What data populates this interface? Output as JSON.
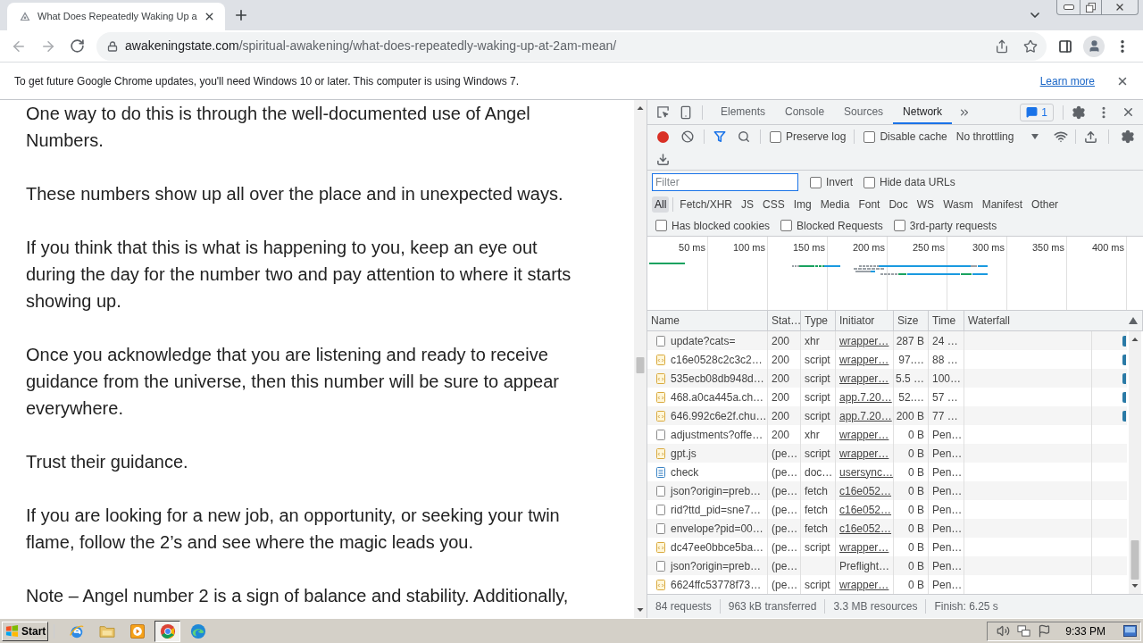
{
  "browser": {
    "tabs": [
      {
        "title": "What Does Repeatedly Waking Up a",
        "selected": true
      }
    ],
    "address": {
      "host": "awakeningstate.com",
      "path": "/spiritual-awakening/what-does-repeatedly-waking-up-at-2am-mean/"
    }
  },
  "infobar": {
    "message": "To get future Google Chrome updates, you'll need Windows 10 or later. This computer is using Windows 7.",
    "link": "Learn more"
  },
  "article": {
    "paragraphs": [
      {
        "lines": [
          "One way to do this is through the well-documented use of Angel",
          "Numbers."
        ]
      },
      {
        "lines": [
          "These numbers show up all over the place and in unexpected ways."
        ]
      },
      {
        "lines": [
          "If you think that this is what is happening to you, keep an eye out",
          "during the day for the number two and pay attention to where it starts",
          "showing up."
        ]
      },
      {
        "lines": [
          "Once you acknowledge that you are listening and ready to receive",
          "guidance from the universe, then this number will be sure to appear",
          "everywhere."
        ]
      },
      {
        "lines": [
          "Trust their guidance."
        ]
      },
      {
        "lines": [
          "If you are looking for a new job, an opportunity, or seeking your twin",
          "flame, follow the 2’s and see where the magic leads you."
        ]
      },
      {
        "lines": [
          "Note – Angel number 2 is a sign of balance and stability. Additionally,"
        ]
      }
    ]
  },
  "devtools": {
    "tabs": [
      {
        "label": "Elements",
        "selected": false
      },
      {
        "label": "Console",
        "selected": false
      },
      {
        "label": "Sources",
        "selected": false
      },
      {
        "label": "Network",
        "selected": true
      }
    ],
    "issues": "1",
    "recording": true,
    "options": [
      {
        "label": "Preserve log",
        "checked": false
      },
      {
        "label": "Disable cache",
        "checked": false
      }
    ],
    "throttling": "No throttling",
    "filter": {
      "placeholder": "Filter"
    },
    "filter_options": [
      {
        "label": "Invert",
        "checked": false
      },
      {
        "label": "Hide data URLs",
        "checked": false
      }
    ],
    "types": [
      {
        "label": "All",
        "selected": true
      },
      {
        "label": "Fetch/XHR",
        "selected": false
      },
      {
        "label": "JS",
        "selected": false
      },
      {
        "label": "CSS",
        "selected": false
      },
      {
        "label": "Img",
        "selected": false
      },
      {
        "label": "Media",
        "selected": false
      },
      {
        "label": "Font",
        "selected": false
      },
      {
        "label": "Doc",
        "selected": false
      },
      {
        "label": "WS",
        "selected": false
      },
      {
        "label": "Wasm",
        "selected": false
      },
      {
        "label": "Manifest",
        "selected": false
      },
      {
        "label": "Other",
        "selected": false
      }
    ],
    "extra_filters": [
      {
        "label": "Has blocked cookies",
        "checked": false
      },
      {
        "label": "Blocked Requests",
        "checked": false
      },
      {
        "label": "3rd-party requests",
        "checked": false
      }
    ],
    "overview": {
      "ticks": [
        "50 ms",
        "100 ms",
        "150 ms",
        "200 ms",
        "250 ms",
        "300 ms",
        "350 ms",
        "400 ms"
      ]
    },
    "table": {
      "columns": [
        "Name",
        "Stat…",
        "Type",
        "Initiator",
        "Size",
        "Time",
        "Waterfall"
      ],
      "rows": [
        {
          "kind": "other",
          "name": "update?cats=",
          "status": "200",
          "type": "xhr",
          "initiator": "wrapper…",
          "initiator_link": true,
          "size": "287 B",
          "time": "24 …",
          "waterfall_bar": true
        },
        {
          "kind": "script",
          "name": "c16e0528c2c3c2…",
          "status": "200",
          "type": "script",
          "initiator": "wrapper…",
          "initiator_link": true,
          "size": "97.…",
          "time": "88 …",
          "waterfall_bar": true
        },
        {
          "kind": "script",
          "name": "535ecb08db948d…",
          "status": "200",
          "type": "script",
          "initiator": "wrapper…",
          "initiator_link": true,
          "size": "5.5 …",
          "time": "100…",
          "waterfall_bar": true
        },
        {
          "kind": "script",
          "name": "468.a0ca445a.ch…",
          "status": "200",
          "type": "script",
          "initiator": "app.7.20…",
          "initiator_link": true,
          "size": "52.…",
          "time": "57 …",
          "waterfall_bar": true
        },
        {
          "kind": "script",
          "name": "646.992c6e2f.chu…",
          "status": "200",
          "type": "script",
          "initiator": "app.7.20…",
          "initiator_link": true,
          "size": "200 B",
          "time": "77 …",
          "waterfall_bar": true
        },
        {
          "kind": "other",
          "name": "adjustments?offe…",
          "status": "200",
          "type": "xhr",
          "initiator": "wrapper…",
          "initiator_link": true,
          "size": "0 B",
          "time": "Pen…",
          "waterfall_bar": false
        },
        {
          "kind": "script",
          "name": "gpt.js",
          "status": "(pe…",
          "type": "script",
          "initiator": "wrapper…",
          "initiator_link": true,
          "size": "0 B",
          "time": "Pen…",
          "waterfall_bar": false
        },
        {
          "kind": "document",
          "name": "check",
          "status": "(pe…",
          "type": "doc…",
          "initiator": "usersync…",
          "initiator_link": true,
          "size": "0 B",
          "time": "Pen…",
          "waterfall_bar": false
        },
        {
          "kind": "other",
          "name": "json?origin=preb…",
          "status": "(pe…",
          "type": "fetch",
          "initiator": "c16e052…",
          "initiator_link": true,
          "size": "0 B",
          "time": "Pen…",
          "waterfall_bar": false
        },
        {
          "kind": "other",
          "name": "rid?ttd_pid=sne7…",
          "status": "(pe…",
          "type": "fetch",
          "initiator": "c16e052…",
          "initiator_link": true,
          "size": "0 B",
          "time": "Pen…",
          "waterfall_bar": false
        },
        {
          "kind": "other",
          "name": "envelope?pid=00…",
          "status": "(pe…",
          "type": "fetch",
          "initiator": "c16e052…",
          "initiator_link": true,
          "size": "0 B",
          "time": "Pen…",
          "waterfall_bar": false
        },
        {
          "kind": "script",
          "name": "dc47ee0bbce5ba…",
          "status": "(pe…",
          "type": "script",
          "initiator": "wrapper…",
          "initiator_link": true,
          "size": "0 B",
          "time": "Pen…",
          "waterfall_bar": false
        },
        {
          "kind": "other",
          "name": "json?origin=preb…",
          "status": "(pe…",
          "initiator": "Preflight…",
          "initiator_link": false,
          "size": "0 B",
          "time": "Pen…",
          "waterfall_bar": false
        },
        {
          "kind": "script",
          "name": "6624ffc53778f73…",
          "status": "(pe…",
          "type": "script",
          "initiator": "wrapper…",
          "initiator_link": true,
          "size": "0 B",
          "time": "Pen…",
          "waterfall_bar": false
        }
      ]
    },
    "summary": [
      "84 requests",
      "963 kB transferred",
      "3.3 MB resources",
      "Finish: 6.25 s"
    ]
  },
  "taskbar": {
    "start": "Start",
    "apps": [
      {
        "selected": false
      },
      {
        "selected": false
      },
      {
        "selected": false
      },
      {
        "selected": true
      },
      {
        "selected": false
      }
    ],
    "clock": "9:33 PM"
  }
}
